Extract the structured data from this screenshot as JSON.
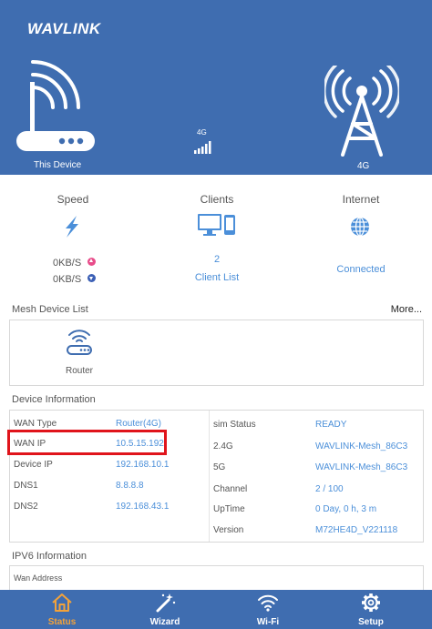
{
  "brand": "WAVLINK",
  "header": {
    "this_device": "This Device",
    "network_mid": "4G",
    "network_right": "4G"
  },
  "stats": {
    "speed_title": "Speed",
    "upload": "0KB/S",
    "download": "0KB/S",
    "clients_title": "Clients",
    "client_count": "2",
    "client_list": "Client List",
    "internet_title": "Internet",
    "internet_status": "Connected"
  },
  "mesh": {
    "title": "Mesh Device List",
    "more": "More...",
    "router_label": "Router"
  },
  "device_info": {
    "title": "Device Information",
    "left": [
      {
        "label": "WAN Type",
        "value": "Router(4G)"
      },
      {
        "label": "WAN IP",
        "value": "10.5.15.192"
      },
      {
        "label": "Device IP",
        "value": "192.168.10.1"
      },
      {
        "label": "DNS1",
        "value": "8.8.8.8"
      },
      {
        "label": "DNS2",
        "value": "192.168.43.1"
      }
    ],
    "right": [
      {
        "label": "sim Status",
        "value": "READY"
      },
      {
        "label": "2.4G",
        "value": "WAVLINK-Mesh_86C3"
      },
      {
        "label": "5G",
        "value": "WAVLINK-Mesh_86C3"
      },
      {
        "label": "Channel",
        "value": "2 / 100"
      },
      {
        "label": "UpTime",
        "value": "0 Day, 0 h, 3 m"
      },
      {
        "label": "Version",
        "value": "M72HE4D_V221118"
      }
    ]
  },
  "ipv6": {
    "title": "IPV6 Information",
    "wan_address": "Wan Address"
  },
  "nav": {
    "items": [
      {
        "label": "Status"
      },
      {
        "label": "Wizard"
      },
      {
        "label": "Wi-Fi"
      },
      {
        "label": "Setup"
      }
    ]
  },
  "colors": {
    "header_bg": "#3f6db0",
    "link_blue": "#4b8fd9",
    "highlight_red": "#e0141b",
    "active_orange": "#f2a23a"
  }
}
